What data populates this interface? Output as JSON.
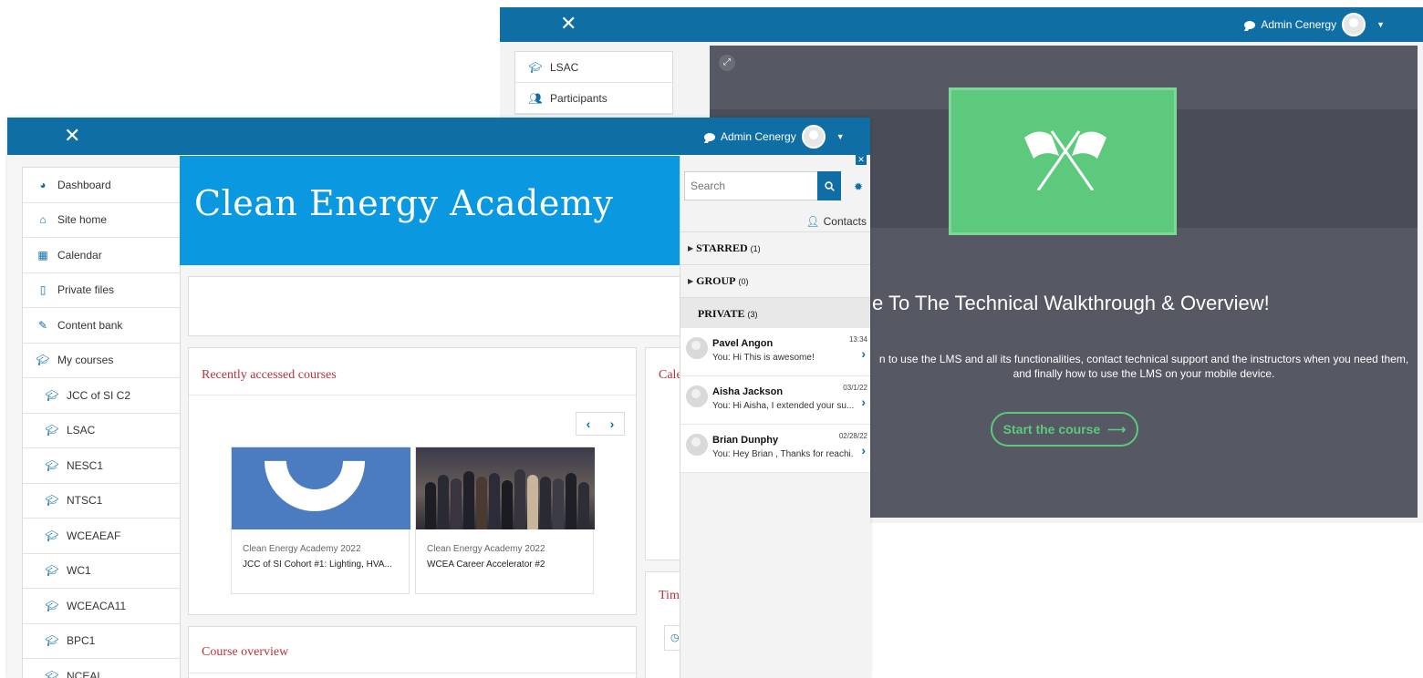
{
  "back_window": {
    "user_name": "Admin Cenergy",
    "sidebar": [
      {
        "label": "LSAC",
        "icon": "graduation-cap-icon"
      },
      {
        "label": "Participants",
        "icon": "users-icon"
      }
    ],
    "title": "e To The Technical Walkthrough & Overview!",
    "description": "n to use the LMS and all its functionalities, contact technical support and the instructors when you need them, and finally how to use the LMS on your mobile device.",
    "cta_label": "Start the course",
    "colors": {
      "accent_green": "#5cc97c",
      "content_bg": "#565863"
    }
  },
  "front_window": {
    "user_name": "Admin Cenergy",
    "banner_title": "Clean Energy Academy",
    "sidebar": [
      {
        "label": "Dashboard",
        "icon": "dashboard-icon",
        "sub": false
      },
      {
        "label": "Site home",
        "icon": "home-icon",
        "sub": false
      },
      {
        "label": "Calendar",
        "icon": "calendar-icon",
        "sub": false
      },
      {
        "label": "Private files",
        "icon": "file-icon",
        "sub": false
      },
      {
        "label": "Content bank",
        "icon": "brush-icon",
        "sub": false
      },
      {
        "label": "My courses",
        "icon": "graduation-cap-icon",
        "sub": false
      },
      {
        "label": "JCC of SI C2",
        "icon": "graduation-cap-icon",
        "sub": true
      },
      {
        "label": "LSAC",
        "icon": "graduation-cap-icon",
        "sub": true
      },
      {
        "label": "NESC1",
        "icon": "graduation-cap-icon",
        "sub": true
      },
      {
        "label": "NTSC1",
        "icon": "graduation-cap-icon",
        "sub": true
      },
      {
        "label": "WCEAEAF",
        "icon": "graduation-cap-icon",
        "sub": true
      },
      {
        "label": "WC1",
        "icon": "graduation-cap-icon",
        "sub": true
      },
      {
        "label": "WCEACA11",
        "icon": "graduation-cap-icon",
        "sub": true
      },
      {
        "label": "BPC1",
        "icon": "graduation-cap-icon",
        "sub": true
      },
      {
        "label": "NCEAL",
        "icon": "graduation-cap-icon",
        "sub": true
      }
    ],
    "recent": {
      "title": "Recently accessed courses",
      "courses": [
        {
          "category": "Clean Energy Academy 2022",
          "name": "JCC of SI Cohort #1: Lighting, HVA..."
        },
        {
          "category": "Clean Energy Academy 2022",
          "name": "WCEA Career Accelerator #2"
        }
      ]
    },
    "overview_title": "Course overview",
    "calendar_title_fragment": "Cale",
    "timeline_title_fragment": "Tim",
    "colors": {
      "navbar": "#0f6fa5",
      "banner": "#0a98e0",
      "panel_title": "#b8323a"
    }
  },
  "drawer": {
    "search_placeholder": "Search",
    "contacts_label": "Contacts",
    "sections": [
      {
        "label": "STARRED",
        "count": "(1)"
      },
      {
        "label": "GROUP",
        "count": "(0)"
      },
      {
        "label": "PRIVATE",
        "count": "(3)"
      }
    ],
    "messages": [
      {
        "name": "Pavel Angon",
        "preview": "You: Hi This is awesome!",
        "time": "13:34"
      },
      {
        "name": "Aisha Jackson",
        "preview": "You: Hi Aisha, I extended your su...",
        "time": "03/1/22"
      },
      {
        "name": "Brian Dunphy",
        "preview": "You: Hey Brian , Thanks for reachi...",
        "time": "02/28/22"
      }
    ]
  }
}
